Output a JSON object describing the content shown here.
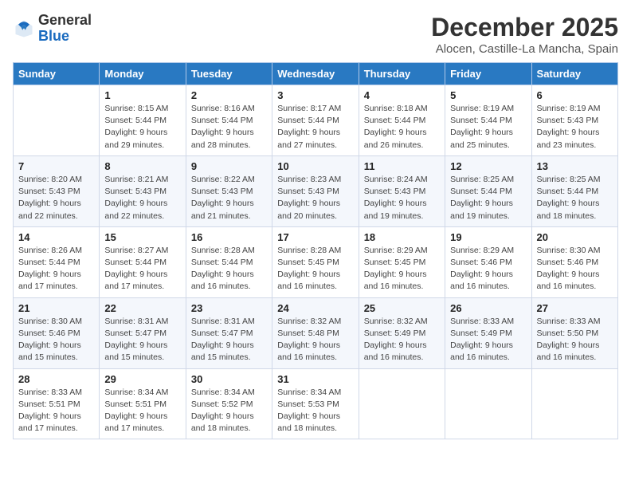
{
  "header": {
    "logo_general": "General",
    "logo_blue": "Blue",
    "main_title": "December 2025",
    "subtitle": "Alocen, Castille-La Mancha, Spain"
  },
  "calendar": {
    "days_of_week": [
      "Sunday",
      "Monday",
      "Tuesday",
      "Wednesday",
      "Thursday",
      "Friday",
      "Saturday"
    ],
    "weeks": [
      [
        {
          "day": "",
          "sunrise": "",
          "sunset": "",
          "daylight": ""
        },
        {
          "day": "1",
          "sunrise": "Sunrise: 8:15 AM",
          "sunset": "Sunset: 5:44 PM",
          "daylight": "Daylight: 9 hours and 29 minutes."
        },
        {
          "day": "2",
          "sunrise": "Sunrise: 8:16 AM",
          "sunset": "Sunset: 5:44 PM",
          "daylight": "Daylight: 9 hours and 28 minutes."
        },
        {
          "day": "3",
          "sunrise": "Sunrise: 8:17 AM",
          "sunset": "Sunset: 5:44 PM",
          "daylight": "Daylight: 9 hours and 27 minutes."
        },
        {
          "day": "4",
          "sunrise": "Sunrise: 8:18 AM",
          "sunset": "Sunset: 5:44 PM",
          "daylight": "Daylight: 9 hours and 26 minutes."
        },
        {
          "day": "5",
          "sunrise": "Sunrise: 8:19 AM",
          "sunset": "Sunset: 5:44 PM",
          "daylight": "Daylight: 9 hours and 25 minutes."
        },
        {
          "day": "6",
          "sunrise": "Sunrise: 8:19 AM",
          "sunset": "Sunset: 5:43 PM",
          "daylight": "Daylight: 9 hours and 23 minutes."
        }
      ],
      [
        {
          "day": "7",
          "sunrise": "Sunrise: 8:20 AM",
          "sunset": "Sunset: 5:43 PM",
          "daylight": "Daylight: 9 hours and 22 minutes."
        },
        {
          "day": "8",
          "sunrise": "Sunrise: 8:21 AM",
          "sunset": "Sunset: 5:43 PM",
          "daylight": "Daylight: 9 hours and 22 minutes."
        },
        {
          "day": "9",
          "sunrise": "Sunrise: 8:22 AM",
          "sunset": "Sunset: 5:43 PM",
          "daylight": "Daylight: 9 hours and 21 minutes."
        },
        {
          "day": "10",
          "sunrise": "Sunrise: 8:23 AM",
          "sunset": "Sunset: 5:43 PM",
          "daylight": "Daylight: 9 hours and 20 minutes."
        },
        {
          "day": "11",
          "sunrise": "Sunrise: 8:24 AM",
          "sunset": "Sunset: 5:43 PM",
          "daylight": "Daylight: 9 hours and 19 minutes."
        },
        {
          "day": "12",
          "sunrise": "Sunrise: 8:25 AM",
          "sunset": "Sunset: 5:44 PM",
          "daylight": "Daylight: 9 hours and 19 minutes."
        },
        {
          "day": "13",
          "sunrise": "Sunrise: 8:25 AM",
          "sunset": "Sunset: 5:44 PM",
          "daylight": "Daylight: 9 hours and 18 minutes."
        }
      ],
      [
        {
          "day": "14",
          "sunrise": "Sunrise: 8:26 AM",
          "sunset": "Sunset: 5:44 PM",
          "daylight": "Daylight: 9 hours and 17 minutes."
        },
        {
          "day": "15",
          "sunrise": "Sunrise: 8:27 AM",
          "sunset": "Sunset: 5:44 PM",
          "daylight": "Daylight: 9 hours and 17 minutes."
        },
        {
          "day": "16",
          "sunrise": "Sunrise: 8:28 AM",
          "sunset": "Sunset: 5:44 PM",
          "daylight": "Daylight: 9 hours and 16 minutes."
        },
        {
          "day": "17",
          "sunrise": "Sunrise: 8:28 AM",
          "sunset": "Sunset: 5:45 PM",
          "daylight": "Daylight: 9 hours and 16 minutes."
        },
        {
          "day": "18",
          "sunrise": "Sunrise: 8:29 AM",
          "sunset": "Sunset: 5:45 PM",
          "daylight": "Daylight: 9 hours and 16 minutes."
        },
        {
          "day": "19",
          "sunrise": "Sunrise: 8:29 AM",
          "sunset": "Sunset: 5:46 PM",
          "daylight": "Daylight: 9 hours and 16 minutes."
        },
        {
          "day": "20",
          "sunrise": "Sunrise: 8:30 AM",
          "sunset": "Sunset: 5:46 PM",
          "daylight": "Daylight: 9 hours and 16 minutes."
        }
      ],
      [
        {
          "day": "21",
          "sunrise": "Sunrise: 8:30 AM",
          "sunset": "Sunset: 5:46 PM",
          "daylight": "Daylight: 9 hours and 15 minutes."
        },
        {
          "day": "22",
          "sunrise": "Sunrise: 8:31 AM",
          "sunset": "Sunset: 5:47 PM",
          "daylight": "Daylight: 9 hours and 15 minutes."
        },
        {
          "day": "23",
          "sunrise": "Sunrise: 8:31 AM",
          "sunset": "Sunset: 5:47 PM",
          "daylight": "Daylight: 9 hours and 15 minutes."
        },
        {
          "day": "24",
          "sunrise": "Sunrise: 8:32 AM",
          "sunset": "Sunset: 5:48 PM",
          "daylight": "Daylight: 9 hours and 16 minutes."
        },
        {
          "day": "25",
          "sunrise": "Sunrise: 8:32 AM",
          "sunset": "Sunset: 5:49 PM",
          "daylight": "Daylight: 9 hours and 16 minutes."
        },
        {
          "day": "26",
          "sunrise": "Sunrise: 8:33 AM",
          "sunset": "Sunset: 5:49 PM",
          "daylight": "Daylight: 9 hours and 16 minutes."
        },
        {
          "day": "27",
          "sunrise": "Sunrise: 8:33 AM",
          "sunset": "Sunset: 5:50 PM",
          "daylight": "Daylight: 9 hours and 16 minutes."
        }
      ],
      [
        {
          "day": "28",
          "sunrise": "Sunrise: 8:33 AM",
          "sunset": "Sunset: 5:51 PM",
          "daylight": "Daylight: 9 hours and 17 minutes."
        },
        {
          "day": "29",
          "sunrise": "Sunrise: 8:34 AM",
          "sunset": "Sunset: 5:51 PM",
          "daylight": "Daylight: 9 hours and 17 minutes."
        },
        {
          "day": "30",
          "sunrise": "Sunrise: 8:34 AM",
          "sunset": "Sunset: 5:52 PM",
          "daylight": "Daylight: 9 hours and 18 minutes."
        },
        {
          "day": "31",
          "sunrise": "Sunrise: 8:34 AM",
          "sunset": "Sunset: 5:53 PM",
          "daylight": "Daylight: 9 hours and 18 minutes."
        },
        {
          "day": "",
          "sunrise": "",
          "sunset": "",
          "daylight": ""
        },
        {
          "day": "",
          "sunrise": "",
          "sunset": "",
          "daylight": ""
        },
        {
          "day": "",
          "sunrise": "",
          "sunset": "",
          "daylight": ""
        }
      ]
    ]
  }
}
